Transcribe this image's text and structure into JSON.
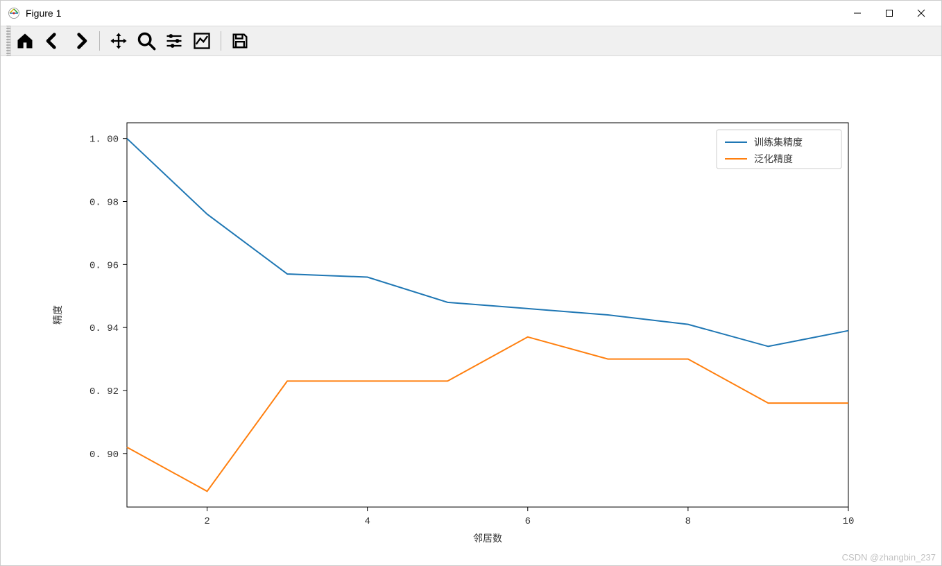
{
  "window": {
    "title": "Figure 1"
  },
  "toolbar": {
    "home": "home-icon",
    "back": "back-icon",
    "forward": "forward-icon",
    "pan": "pan-icon",
    "zoom": "zoom-icon",
    "configure": "configure-icon",
    "axes": "axes-icon",
    "save": "save-icon"
  },
  "watermark": "CSDN @zhangbin_237",
  "chart_data": {
    "type": "line",
    "xlabel": "邻居数",
    "ylabel": "精度",
    "x": [
      1,
      2,
      3,
      4,
      5,
      6,
      7,
      8,
      9,
      10
    ],
    "x_ticks": [
      2,
      4,
      6,
      8,
      10
    ],
    "y_ticks": [
      0.9,
      0.92,
      0.94,
      0.96,
      0.98,
      1.0
    ],
    "xlim": [
      1,
      10
    ],
    "ylim": [
      0.883,
      1.005
    ],
    "legend_position": "upper-right",
    "series": [
      {
        "name": "训练集精度",
        "color": "#1f77b4",
        "values": [
          1.0,
          0.976,
          0.957,
          0.956,
          0.948,
          0.946,
          0.944,
          0.941,
          0.934,
          0.939
        ]
      },
      {
        "name": "泛化精度",
        "color": "#ff7f0e",
        "values": [
          0.902,
          0.888,
          0.923,
          0.923,
          0.923,
          0.937,
          0.93,
          0.93,
          0.916,
          0.916
        ]
      }
    ]
  }
}
